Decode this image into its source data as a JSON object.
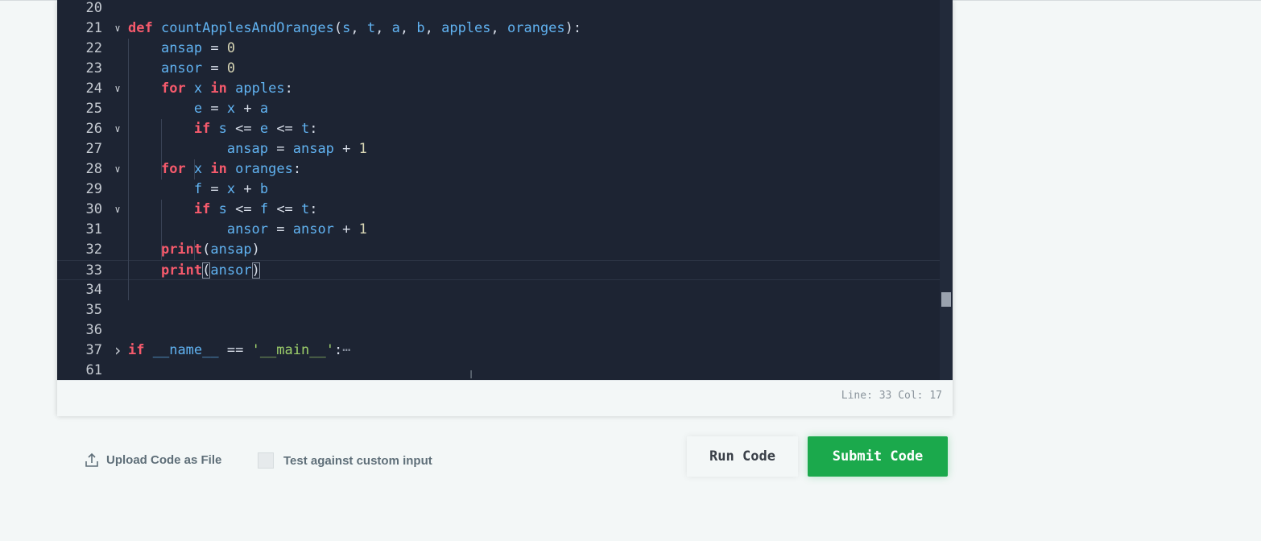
{
  "editor": {
    "lines": [
      {
        "n": "20",
        "fold": "",
        "tokens": []
      },
      {
        "n": "21",
        "fold": "v",
        "tokens": [
          [
            "kw",
            "def"
          ],
          [
            "op",
            " "
          ],
          [
            "id",
            "countApplesAndOranges"
          ],
          [
            "op",
            "("
          ],
          [
            "id",
            "s"
          ],
          [
            "op",
            ", "
          ],
          [
            "id",
            "t"
          ],
          [
            "op",
            ", "
          ],
          [
            "id",
            "a"
          ],
          [
            "op",
            ", "
          ],
          [
            "id",
            "b"
          ],
          [
            "op",
            ", "
          ],
          [
            "id",
            "apples"
          ],
          [
            "op",
            ", "
          ],
          [
            "id",
            "oranges"
          ],
          [
            "op",
            "):"
          ]
        ]
      },
      {
        "n": "22",
        "fold": "",
        "tokens": [
          [
            "op",
            "    "
          ],
          [
            "id",
            "ansap"
          ],
          [
            "op",
            " = "
          ],
          [
            "num",
            "0"
          ]
        ]
      },
      {
        "n": "23",
        "fold": "",
        "tokens": [
          [
            "op",
            "    "
          ],
          [
            "id",
            "ansor"
          ],
          [
            "op",
            " = "
          ],
          [
            "num",
            "0"
          ]
        ]
      },
      {
        "n": "24",
        "fold": "v",
        "tokens": [
          [
            "op",
            "    "
          ],
          [
            "kw",
            "for"
          ],
          [
            "op",
            " "
          ],
          [
            "id",
            "x"
          ],
          [
            "op",
            " "
          ],
          [
            "kw",
            "in"
          ],
          [
            "op",
            " "
          ],
          [
            "id",
            "apples"
          ],
          [
            "op",
            ":"
          ]
        ]
      },
      {
        "n": "25",
        "fold": "",
        "tokens": [
          [
            "op",
            "        "
          ],
          [
            "id",
            "e"
          ],
          [
            "op",
            " = "
          ],
          [
            "id",
            "x"
          ],
          [
            "op",
            " + "
          ],
          [
            "id",
            "a"
          ]
        ]
      },
      {
        "n": "26",
        "fold": "v",
        "tokens": [
          [
            "op",
            "        "
          ],
          [
            "kw",
            "if"
          ],
          [
            "op",
            " "
          ],
          [
            "id",
            "s"
          ],
          [
            "op",
            " <= "
          ],
          [
            "id",
            "e"
          ],
          [
            "op",
            " <= "
          ],
          [
            "id",
            "t"
          ],
          [
            "op",
            ":"
          ]
        ]
      },
      {
        "n": "27",
        "fold": "",
        "tokens": [
          [
            "op",
            "            "
          ],
          [
            "id",
            "ansap"
          ],
          [
            "op",
            " = "
          ],
          [
            "id",
            "ansap"
          ],
          [
            "op",
            " + "
          ],
          [
            "num",
            "1"
          ]
        ]
      },
      {
        "n": "28",
        "fold": "v",
        "tokens": [
          [
            "op",
            "    "
          ],
          [
            "kw",
            "for"
          ],
          [
            "op",
            " "
          ],
          [
            "id",
            "x"
          ],
          [
            "op",
            " "
          ],
          [
            "kw",
            "in"
          ],
          [
            "op",
            " "
          ],
          [
            "id",
            "oranges"
          ],
          [
            "op",
            ":"
          ]
        ]
      },
      {
        "n": "29",
        "fold": "",
        "tokens": [
          [
            "op",
            "        "
          ],
          [
            "id",
            "f"
          ],
          [
            "op",
            " = "
          ],
          [
            "id",
            "x"
          ],
          [
            "op",
            " + "
          ],
          [
            "id",
            "b"
          ]
        ]
      },
      {
        "n": "30",
        "fold": "v",
        "tokens": [
          [
            "op",
            "        "
          ],
          [
            "kw",
            "if"
          ],
          [
            "op",
            " "
          ],
          [
            "id",
            "s"
          ],
          [
            "op",
            " <= "
          ],
          [
            "id",
            "f"
          ],
          [
            "op",
            " <= "
          ],
          [
            "id",
            "t"
          ],
          [
            "op",
            ":"
          ]
        ]
      },
      {
        "n": "31",
        "fold": "",
        "tokens": [
          [
            "op",
            "            "
          ],
          [
            "id",
            "ansor"
          ],
          [
            "op",
            " = "
          ],
          [
            "id",
            "ansor"
          ],
          [
            "op",
            " + "
          ],
          [
            "num",
            "1"
          ]
        ]
      },
      {
        "n": "32",
        "fold": "",
        "tokens": [
          [
            "op",
            "    "
          ],
          [
            "kw",
            "print"
          ],
          [
            "op",
            "("
          ],
          [
            "id",
            "ansap"
          ],
          [
            "op",
            ")"
          ]
        ]
      },
      {
        "n": "33",
        "fold": "",
        "tokens": [
          [
            "op",
            "    "
          ],
          [
            "kw",
            "print"
          ],
          [
            "bracket",
            "("
          ],
          [
            "id",
            "ansor"
          ],
          [
            "bracket",
            ")"
          ]
        ]
      },
      {
        "n": "34",
        "fold": "",
        "tokens": []
      },
      {
        "n": "35",
        "fold": "",
        "tokens": []
      },
      {
        "n": "36",
        "fold": "",
        "tokens": []
      },
      {
        "n": "37",
        "fold": ">",
        "tokens": [
          [
            "kw",
            "if"
          ],
          [
            "op",
            " "
          ],
          [
            "id",
            "__name__"
          ],
          [
            "op",
            " == "
          ],
          [
            "str",
            "'__main__'"
          ],
          [
            "op",
            ":"
          ],
          [
            "dots",
            "⋯"
          ]
        ]
      },
      {
        "n": "61",
        "fold": "",
        "tokens": []
      }
    ],
    "active_line": "33"
  },
  "status": {
    "text": "Line: 33 Col: 17"
  },
  "footer": {
    "upload_label": "Upload Code as File",
    "custom_input_label": "Test against custom input",
    "run_label": "Run Code",
    "submit_label": "Submit Code"
  },
  "colors": {
    "editor_bg": "#1d2433",
    "keyword": "#f55a6c",
    "identifier": "#61b3f2",
    "submit_green": "#1ba94c"
  },
  "icons": {
    "upload": "upload-icon",
    "fold_open": "chevron-down-icon",
    "fold_closed": "chevron-right-icon"
  }
}
